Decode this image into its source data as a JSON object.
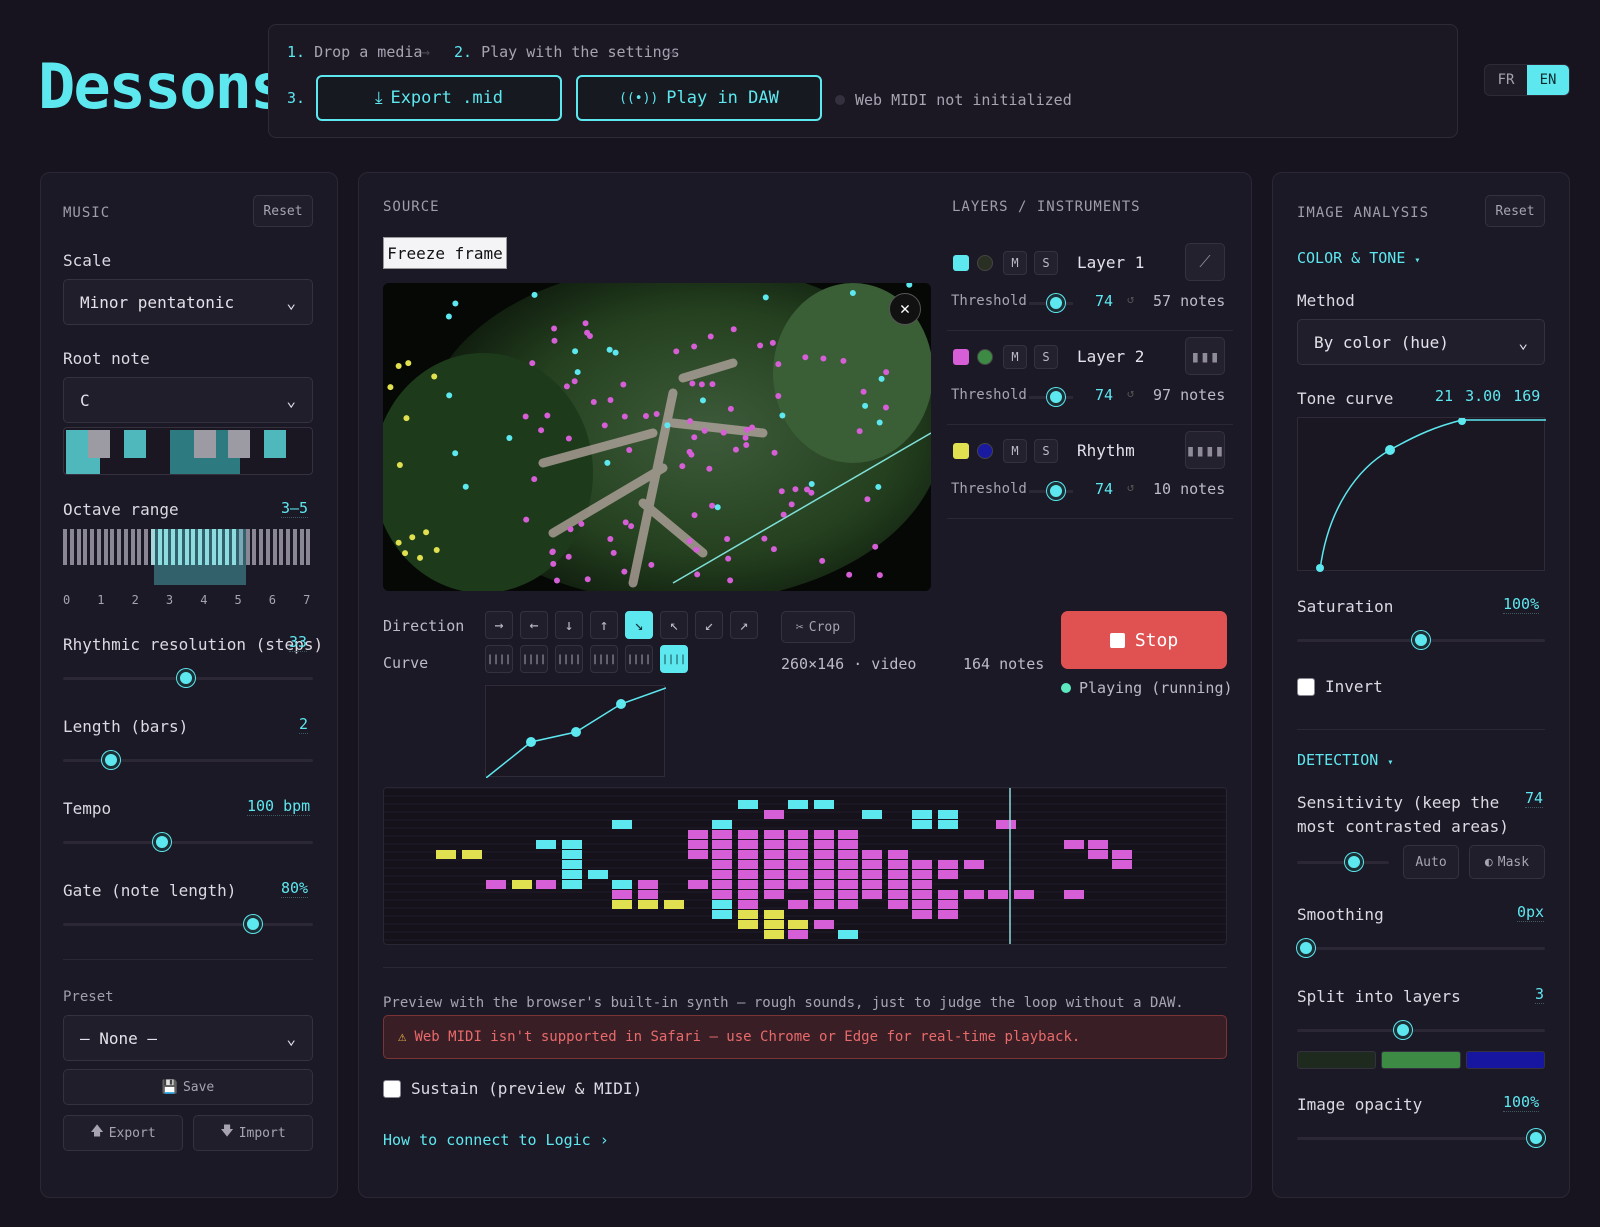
{
  "app": {
    "logo": "Dessons"
  },
  "steps": {
    "step1_num": "1.",
    "step1": "Drop a media",
    "step2_num": "2.",
    "step2": "Play with the settings",
    "step3_num": "3.",
    "export_label": "Export .mid",
    "daw_label": "Play in DAW",
    "midi_status": "Web MIDI not initialized"
  },
  "lang": {
    "fr": "FR",
    "en": "EN",
    "active": "EN"
  },
  "music": {
    "title": "MUSIC",
    "reset": "Reset",
    "scale_label": "Scale",
    "scale_value": "Minor pentatonic",
    "root_label": "Root note",
    "root_value": "C",
    "octave_label": "Octave range",
    "octave_value": "3–5",
    "octave_ticks": [
      "0",
      "1",
      "2",
      "3",
      "4",
      "5",
      "6",
      "7"
    ],
    "rhythm_label": "Rhythmic resolution (steps)",
    "rhythm_value": "33",
    "rhythm_pos": 0.49,
    "length_label": "Length (bars)",
    "length_value": "2",
    "length_pos": 0.17,
    "tempo_label": "Tempo",
    "tempo_value": "100 bpm",
    "tempo_pos": 0.39,
    "gate_label": "Gate (note length)",
    "gate_value": "80%",
    "gate_pos": 0.78,
    "preset_label": "Preset",
    "preset_value": "— None —",
    "save": "Save",
    "export": "Export",
    "import": "Import"
  },
  "source": {
    "title": "SOURCE",
    "freeze": "Freeze frame",
    "direction_label": "Direction",
    "curve_label": "Curve",
    "crop": "Crop",
    "dimensions": "260×146 · video",
    "notes_total": "164 notes",
    "stop": "Stop",
    "playing": "Playing (running)",
    "preview_note": "Preview with the browser's built-in synth — rough sounds, just to judge the loop without a DAW.",
    "warning": "Web MIDI isn't supported in Safari — use Chrome or Edge for real-time playback.",
    "sustain": "Sustain (preview & MIDI)",
    "how_to": "How to connect to Logic ›"
  },
  "layers": {
    "title": "LAYERS / INSTRUMENTS",
    "items": [
      {
        "name": "Layer 1",
        "threshold_label": "Threshold",
        "threshold": "74",
        "notes": "57 notes",
        "color": "#5de8f0",
        "dot": "#2a2f24"
      },
      {
        "name": "Layer 2",
        "threshold_label": "Threshold",
        "threshold": "74",
        "notes": "97 notes",
        "color": "#d65ed6",
        "dot": "#3c8a44"
      },
      {
        "name": "Rhythm",
        "threshold_label": "Threshold",
        "threshold": "74",
        "notes": "10 notes",
        "color": "#e0e050",
        "dot": "#1a1aa0"
      }
    ],
    "mute": "M",
    "solo": "S"
  },
  "analysis": {
    "title": "IMAGE ANALYSIS",
    "reset": "Reset",
    "color_tone": "COLOR & TONE",
    "method_label": "Method",
    "method_value": "By color (hue)",
    "tone_label": "Tone curve",
    "tone_v1": "21",
    "tone_v2": "3.00",
    "tone_v3": "169",
    "saturation_label": "Saturation",
    "saturation_value": "100%",
    "saturation_pos": 0.5,
    "invert": "Invert",
    "detection": "DETECTION",
    "sensitivity_label": "Sensitivity (keep the most contrasted areas)",
    "sensitivity_value": "74",
    "sensitivity_pos": 0.65,
    "auto": "Auto",
    "mask": "Mask",
    "smoothing_label": "Smoothing",
    "smoothing_value": "0px",
    "smoothing_pos": 0.0,
    "split_label": "Split into layers",
    "split_value": "3",
    "split_pos": 0.42,
    "split_colors": [
      "#1f2a1e",
      "#3c8a44",
      "#1616a0"
    ],
    "opacity_label": "Image opacity",
    "opacity_value": "100%",
    "opacity_pos": 1.0
  }
}
